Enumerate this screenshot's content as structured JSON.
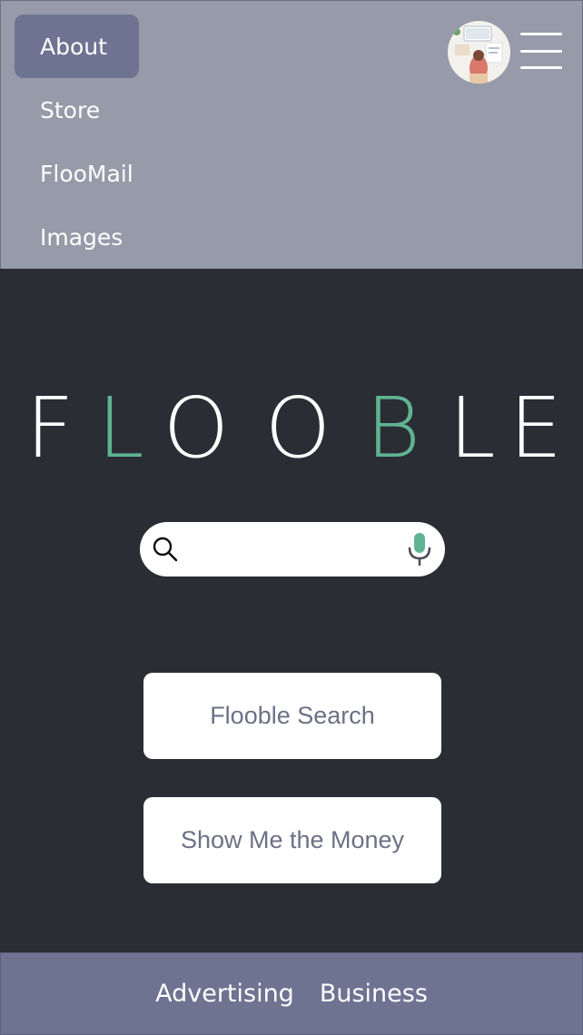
{
  "nav": {
    "items": [
      {
        "label": "About",
        "active": true
      },
      {
        "label": "Store",
        "active": false
      },
      {
        "label": "FlooMail",
        "active": false
      },
      {
        "label": "Images",
        "active": false
      }
    ]
  },
  "header": {
    "avatar_icon": "user-avatar-icon",
    "menu_icon": "hamburger-menu-icon"
  },
  "logo": {
    "letters": [
      "F",
      "L",
      "O",
      "O",
      "B",
      "L",
      "E"
    ],
    "colors": [
      "#ffffff",
      "#5fb393",
      "#ffffff",
      "#ffffff",
      "#5fb393",
      "#ffffff",
      "#ffffff"
    ]
  },
  "search": {
    "value": "",
    "placeholder": "",
    "search_icon": "search-icon",
    "mic_icon": "microphone-icon"
  },
  "buttons": {
    "search_label": "Flooble Search",
    "money_label": "Show Me the Money"
  },
  "footer": {
    "links": [
      "Advertising",
      "Business"
    ]
  },
  "colors": {
    "header_bg": "#979aa8",
    "active_nav_bg": "#6e7391",
    "body_bg": "#2a2d34",
    "accent_green": "#5fb393",
    "footer_bg": "#6e7391",
    "button_text": "#6c7185"
  }
}
